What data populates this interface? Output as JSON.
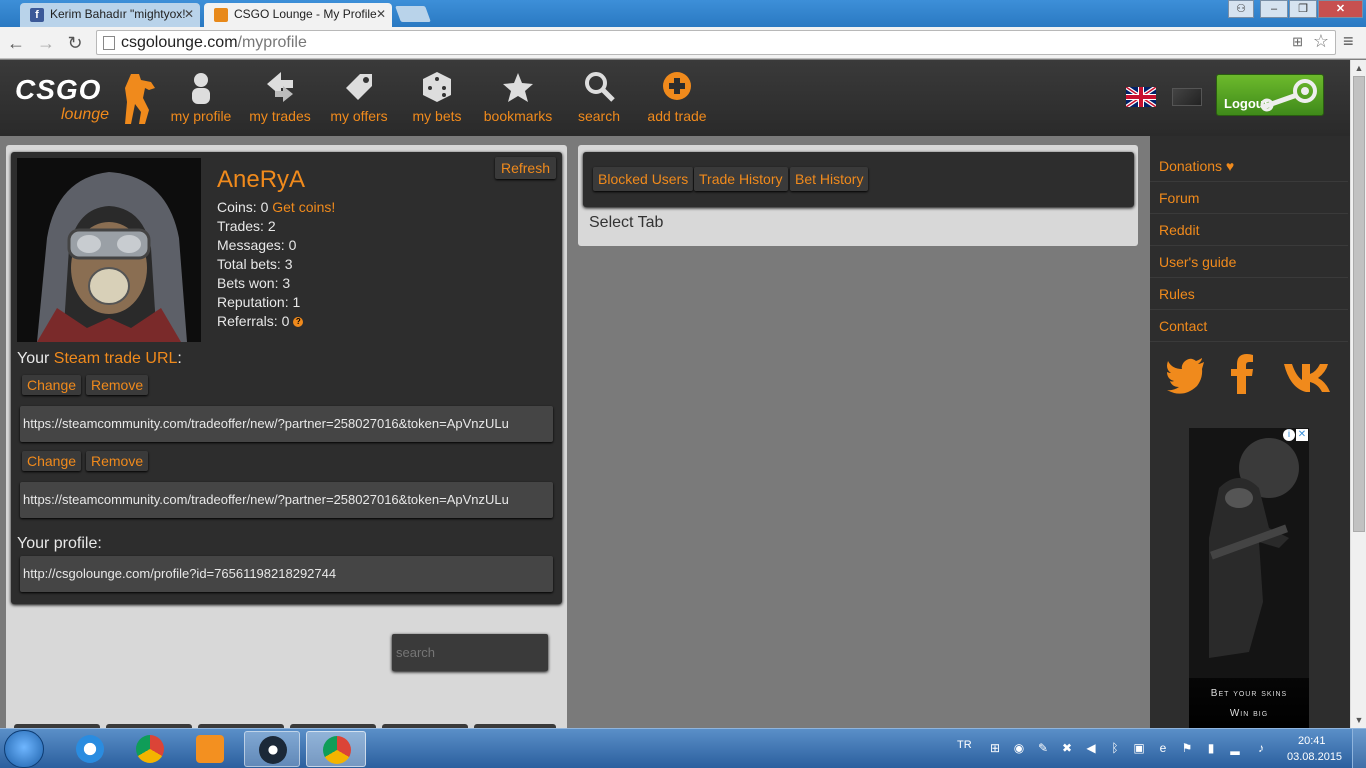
{
  "browser": {
    "tabs": [
      {
        "label": "Kerim Bahadır \"mightyox!"
      },
      {
        "label": "CSGO Lounge - My Profile"
      }
    ],
    "url_host": "csgolounge.com",
    "url_path": "/myprofile"
  },
  "header": {
    "logo_main": "CSGO",
    "logo_sub": "lounge",
    "nav": [
      {
        "label": "my profile",
        "icon": "person-icon"
      },
      {
        "label": "my trades",
        "icon": "trades-icon"
      },
      {
        "label": "my offers",
        "icon": "tag-icon"
      },
      {
        "label": "my bets",
        "icon": "dice-icon"
      },
      {
        "label": "bookmarks",
        "icon": "star-icon"
      },
      {
        "label": "search",
        "icon": "magnifier-icon"
      },
      {
        "label": "add trade",
        "icon": "plus-circle-icon"
      }
    ],
    "logout_label": "Logout"
  },
  "profile": {
    "refresh_label": "Refresh",
    "username": "AneRyA",
    "coins_label": "Coins: 0",
    "get_coins": "Get coins!",
    "trades": "Trades: 2",
    "messages": "Messages: 0",
    "total_bets": "Total bets: 3",
    "bets_won": "Bets won: 3",
    "reputation": "Reputation: 1",
    "referrals": "Referrals: 0",
    "trade_url_prefix": "Your ",
    "trade_url_link": "Steam trade URL",
    "trade_url_suffix": ":",
    "change_label": "Change",
    "remove_label": "Remove",
    "trade_url_1": "https://steamcommunity.com/tradeoffer/new/?partner=258027016&token=ApVnzULu",
    "trade_url_2": "https://steamcommunity.com/tradeoffer/new/?partner=258027016&token=ApVnzULu",
    "your_profile_label": "Your profile:",
    "profile_url": "http://csgolounge.com/profile?id=76561198218292744",
    "search_placeholder": "search"
  },
  "tabs_panel": {
    "tabs": [
      "Blocked Users",
      "Trade History",
      "Bet History"
    ],
    "select_tab": "Select Tab"
  },
  "sidebar": {
    "items": [
      "Donations ♥",
      "Forum",
      "Reddit",
      "User's guide",
      "Rules",
      "Contact"
    ],
    "ad_line1": "Bet your skins",
    "ad_line2": "Win big"
  },
  "taskbar": {
    "lang": "TR",
    "time": "20:41",
    "date": "03.08.2015"
  },
  "colors": {
    "accent": "#f08a1c",
    "panel": "#2d2d2d",
    "logout": "#4f9e22"
  }
}
